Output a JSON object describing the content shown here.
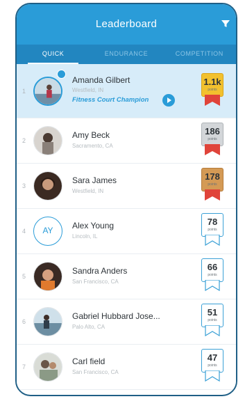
{
  "header": {
    "title": "Leaderboard",
    "filter_icon": "filter-icon"
  },
  "tabs": [
    {
      "label": "QUICK",
      "active": true
    },
    {
      "label": "ENDURANCE",
      "active": false
    },
    {
      "label": "COMPETITION",
      "active": false
    }
  ],
  "champion_label": "Fitness Court Champion",
  "points_label": "points",
  "entries": [
    {
      "rank": "1",
      "name": "Amanda Gilbert",
      "location": "Westfield, IN",
      "points": "1.1k",
      "badge": "gold"
    },
    {
      "rank": "2",
      "name": "Amy Beck",
      "location": "Sacramento, CA",
      "points": "186",
      "badge": "silver"
    },
    {
      "rank": "3",
      "name": "Sara James",
      "location": "Westfield, IN",
      "points": "178",
      "badge": "bronze"
    },
    {
      "rank": "4",
      "name": "Alex Young",
      "location": "Lincoln, IL",
      "points": "78",
      "badge": "plain",
      "initials": "AY"
    },
    {
      "rank": "5",
      "name": "Sandra Anders",
      "location": "San Francisco, CA",
      "points": "66",
      "badge": "plain"
    },
    {
      "rank": "6",
      "name": "Gabriel Hubbard Jose...",
      "location": "Palo Alto, CA",
      "points": "51",
      "badge": "plain"
    },
    {
      "rank": "7",
      "name": "Carl field",
      "location": "San Francisco, CA",
      "points": "47",
      "badge": "plain"
    }
  ],
  "colors": {
    "primary": "#2a9cd8",
    "tabbar": "#2286c0",
    "highlight": "#d7ecf9",
    "gold": "#f2c12e",
    "silver": "#d3d6d9",
    "bronze": "#d49a55"
  }
}
